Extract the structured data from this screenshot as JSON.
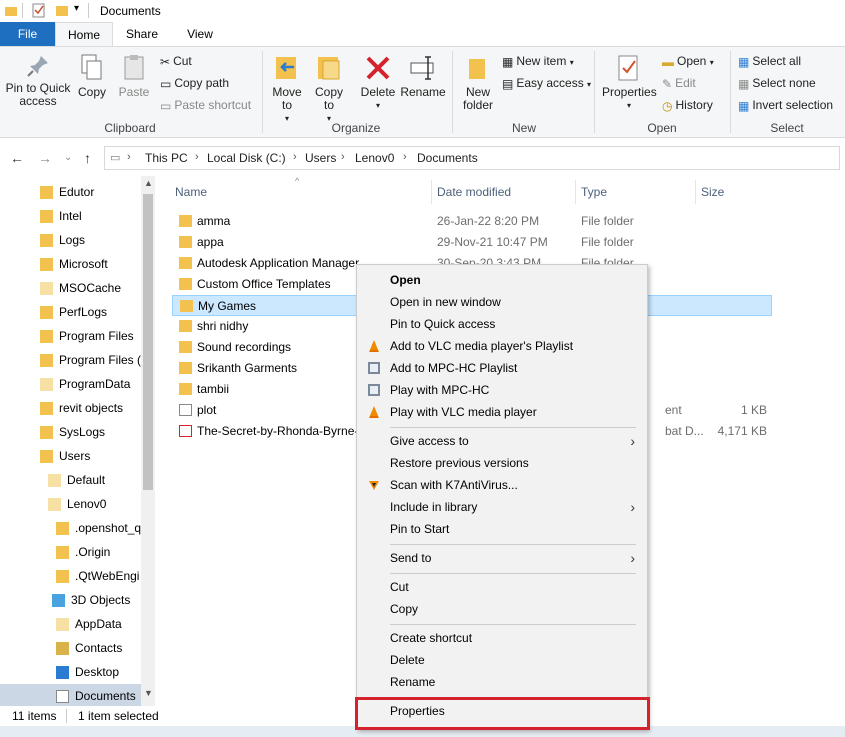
{
  "window": {
    "title": "Documents"
  },
  "ribbon_tabs": [
    "File",
    "Home",
    "Share",
    "View"
  ],
  "clipboard": {
    "pin": "Pin to Quick access",
    "copy": "Copy",
    "paste": "Paste",
    "cut": "Cut",
    "copy_path": "Copy path",
    "paste_shortcut": "Paste shortcut",
    "label": "Clipboard"
  },
  "organize": {
    "move_to": "Move to",
    "copy_to": "Copy to",
    "delete": "Delete",
    "rename": "Rename",
    "label": "Organize"
  },
  "new": {
    "new_folder": "New folder",
    "new_item": "New item",
    "easy_access": "Easy access",
    "label": "New"
  },
  "open": {
    "properties": "Properties",
    "open": "Open",
    "edit": "Edit",
    "history": "History",
    "label": "Open"
  },
  "select": {
    "select_all": "Select all",
    "select_none": "Select none",
    "invert": "Invert selection",
    "label": "Select"
  },
  "breadcrumb": [
    "This PC",
    "Local Disk (C:)",
    "Users",
    "Lenov0",
    "Documents"
  ],
  "nav_items": [
    {
      "label": "Edutor"
    },
    {
      "label": "Intel"
    },
    {
      "label": "Logs"
    },
    {
      "label": "Microsoft"
    },
    {
      "label": "MSOCache"
    },
    {
      "label": "PerfLogs"
    },
    {
      "label": "Program Files"
    },
    {
      "label": "Program Files ("
    },
    {
      "label": "ProgramData"
    },
    {
      "label": "revit objects"
    },
    {
      "label": "SysLogs"
    },
    {
      "label": "Users"
    },
    {
      "label": "Default"
    },
    {
      "label": "Lenov0"
    },
    {
      "label": ".openshot_q"
    },
    {
      "label": ".Origin"
    },
    {
      "label": ".QtWebEngi"
    },
    {
      "label": "3D Objects"
    },
    {
      "label": "AppData"
    },
    {
      "label": "Contacts"
    },
    {
      "label": "Desktop"
    },
    {
      "label": "Documents"
    }
  ],
  "columns": {
    "name": "Name",
    "date": "Date modified",
    "type": "Type",
    "size": "Size"
  },
  "files": [
    {
      "name": "amma",
      "date": "26-Jan-22 8:20 PM",
      "type": "File folder",
      "size": ""
    },
    {
      "name": "appa",
      "date": "29-Nov-21 10:47 PM",
      "type": "File folder",
      "size": ""
    },
    {
      "name": "Autodesk Application Manager",
      "date": "30-Sep-20 3:43 PM",
      "type": "File folder",
      "size": ""
    },
    {
      "name": "Custom Office Templates",
      "date": "",
      "type": "",
      "size": ""
    },
    {
      "name": "My Games",
      "date": "",
      "type": "",
      "size": ""
    },
    {
      "name": "shri nidhy",
      "date": "",
      "type": "",
      "size": ""
    },
    {
      "name": "Sound recordings",
      "date": "",
      "type": "",
      "size": ""
    },
    {
      "name": "Srikanth Garments",
      "date": "",
      "type": "",
      "size": ""
    },
    {
      "name": "tambii",
      "date": "",
      "type": "",
      "size": ""
    },
    {
      "name": "plot",
      "date": "",
      "type": "ent",
      "size": "1 KB"
    },
    {
      "name": "The-Secret-by-Rhonda-Byrne-",
      "date": "",
      "type": "bat D...",
      "size": "4,171 KB"
    }
  ],
  "status": {
    "items": "11 items",
    "selected": "1 item selected"
  },
  "context_menu": {
    "open": "Open",
    "open_new_window": "Open in new window",
    "pin_quick": "Pin to Quick access",
    "vlc_playlist": "Add to VLC media player's Playlist",
    "mpc_playlist": "Add to MPC-HC Playlist",
    "play_mpc": "Play with MPC-HC",
    "play_vlc": "Play with VLC media player",
    "give_access": "Give access to",
    "restore": "Restore previous versions",
    "scan": "Scan with K7AntiVirus...",
    "include_library": "Include in library",
    "pin_start": "Pin to Start",
    "send_to": "Send to",
    "cut": "Cut",
    "copy": "Copy",
    "create_shortcut": "Create shortcut",
    "delete": "Delete",
    "rename": "Rename",
    "properties": "Properties"
  },
  "colors": {
    "highlight": "#d4232c",
    "folder": "#f2c14e",
    "selection": "#cce8ff",
    "file_tab": "#1e6fbf"
  }
}
